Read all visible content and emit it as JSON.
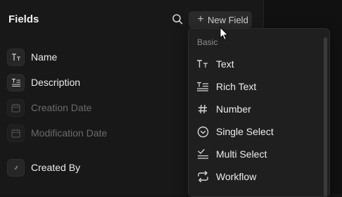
{
  "panel": {
    "title": "Fields",
    "new_field_label": "New Field"
  },
  "fields": [
    {
      "label": "Name",
      "icon": "text-type-icon",
      "dimmed": false
    },
    {
      "label": "Description",
      "icon": "rich-text-icon",
      "dimmed": false
    },
    {
      "label": "Creation Date",
      "icon": "calendar-icon",
      "dimmed": true
    },
    {
      "label": "Modification Date",
      "icon": "calendar-icon",
      "dimmed": true
    },
    {
      "label": "Created By",
      "icon": "user-icon",
      "dimmed": false
    }
  ],
  "dropdown": {
    "section": "Basic",
    "items": [
      {
        "label": "Text",
        "icon": "text-type-icon"
      },
      {
        "label": "Rich Text",
        "icon": "rich-text-icon"
      },
      {
        "label": "Number",
        "icon": "hash-icon"
      },
      {
        "label": "Single Select",
        "icon": "circle-chevron-icon"
      },
      {
        "label": "Multi Select",
        "icon": "checklist-icon"
      },
      {
        "label": "Workflow",
        "icon": "repeat-icon"
      }
    ]
  },
  "colors": {
    "background": "#181818",
    "menu_background": "#1f1f1f",
    "text": "#ececec",
    "muted_text": "#6b6b6b"
  }
}
